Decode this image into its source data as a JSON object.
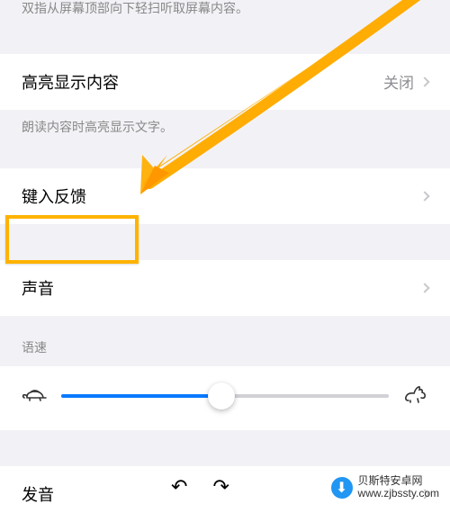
{
  "hints": {
    "topHint": "双指从屏幕顶部向下轻扫听取屏幕内容。",
    "highlightHint": "朗读内容时高亮显示文字。",
    "speedLabel": "语速"
  },
  "rows": {
    "highlightContent": {
      "label": "高亮显示内容",
      "value": "关闭"
    },
    "typingFeedback": {
      "label": "键入反馈"
    },
    "sound": {
      "label": "声音"
    },
    "voice": {
      "label": "发音"
    }
  },
  "slider": {
    "percent": 49
  },
  "watermark": {
    "line1": "贝斯特安卓网",
    "url": "www.zjbssty.com"
  }
}
